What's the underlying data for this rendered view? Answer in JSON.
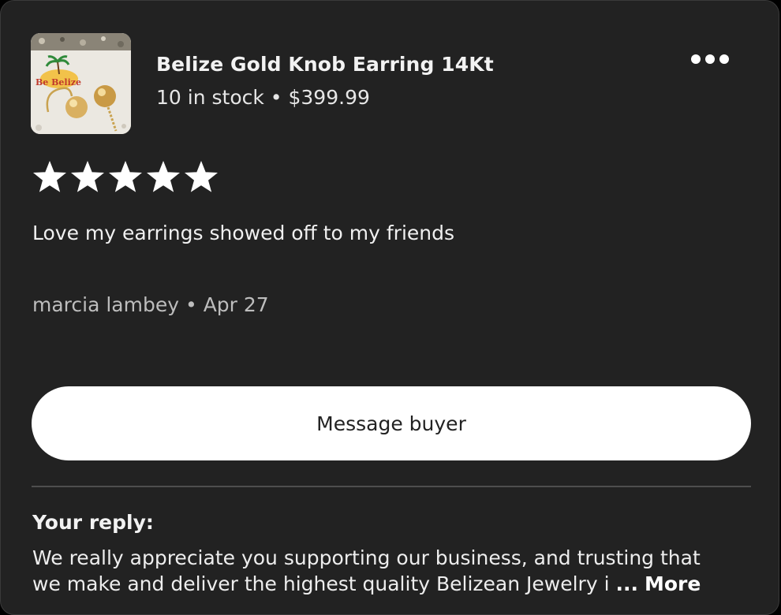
{
  "listing": {
    "title": "Belize Gold Knob Earring 14Kt",
    "stock": "10 in stock",
    "separator": "•",
    "price": "$399.99",
    "thumbnail_brand": "Be Belize"
  },
  "review": {
    "rating": 5,
    "max_rating": 5,
    "text": "Love my earrings showed off to my friends",
    "reviewer": "marcia lambey",
    "separator": "•",
    "date": "Apr 27"
  },
  "actions": {
    "message_buyer_label": "Message buyer",
    "more_menu_icon": "more-horizontal-icon"
  },
  "reply": {
    "heading": "Your reply:",
    "line1": "We really appreciate you supporting our business, and trusting that",
    "line2": "we make and deliver the highest quality Belizean Jewelry i",
    "ellipsis": "...",
    "more_label": "More"
  },
  "colors": {
    "background": "#222222",
    "text_primary": "#f2f2f2",
    "text_secondary": "#bdbdbd",
    "button_bg": "#ffffff",
    "star": "#ffffff",
    "divider": "#4e4e4e"
  }
}
